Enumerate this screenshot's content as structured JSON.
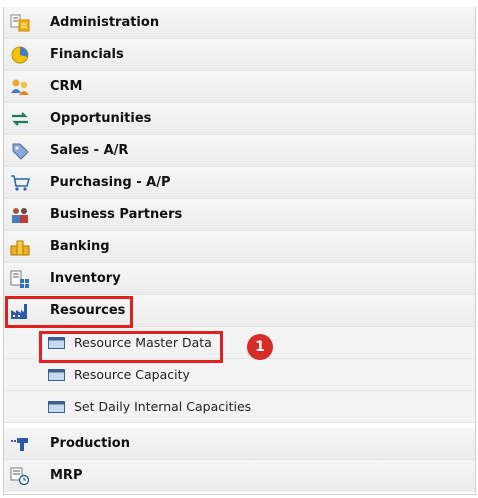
{
  "menu": {
    "items": [
      {
        "label": "Administration",
        "icon": "administration-icon"
      },
      {
        "label": "Financials",
        "icon": "financials-icon"
      },
      {
        "label": "CRM",
        "icon": "crm-icon"
      },
      {
        "label": "Opportunities",
        "icon": "opportunities-icon"
      },
      {
        "label": "Sales - A/R",
        "icon": "sales-icon"
      },
      {
        "label": "Purchasing - A/P",
        "icon": "purchasing-cart-icon"
      },
      {
        "label": "Business Partners",
        "icon": "business-partners-icon"
      },
      {
        "label": "Banking",
        "icon": "banking-icon"
      },
      {
        "label": "Inventory",
        "icon": "inventory-icon"
      },
      {
        "label": "Resources",
        "icon": "resources-factory-icon"
      },
      {
        "label": "Production",
        "icon": "production-icon"
      },
      {
        "label": "MRP",
        "icon": "mrp-icon"
      }
    ],
    "resources_sub": [
      {
        "label": "Resource Master Data",
        "icon": "form-window-icon"
      },
      {
        "label": "Resource Capacity",
        "icon": "form-window-icon"
      },
      {
        "label": "Set Daily Internal Capacities",
        "icon": "form-window-icon"
      }
    ]
  },
  "annotation": {
    "step": "1"
  },
  "colors": {
    "highlight": "#e0201e",
    "badge": "#d62b27"
  }
}
